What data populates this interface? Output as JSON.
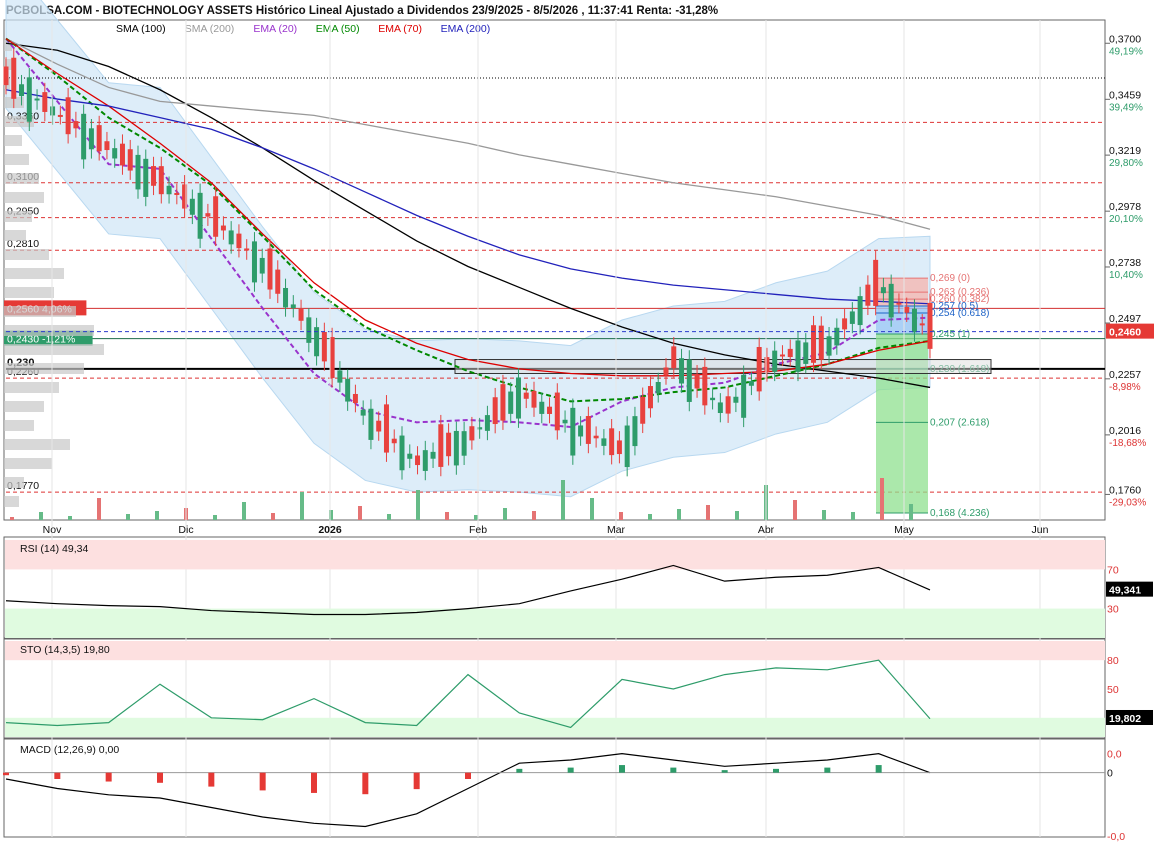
{
  "header": {
    "title": "PCBOLSA.COM - BIOTECHNOLOGY ASSETS Histórico Lineal Ajustado a Dividendos 23/9/2025 - 8/5/2026 , 11:37:41 Renta: -31,28%",
    "legend": [
      {
        "label": "SMA (100)",
        "color": "#000000"
      },
      {
        "label": "SMA (200)",
        "color": "#999999"
      },
      {
        "label": "EMA (20)",
        "color": "#9933cc"
      },
      {
        "label": "EMA (50)",
        "color": "#008800"
      },
      {
        "label": "EMA (70)",
        "color": "#dd0000"
      },
      {
        "label": "EMA (200)",
        "color": "#2222bb"
      }
    ]
  },
  "colors": {
    "up": "#2e9c6a",
    "down": "#e8413e",
    "bollinger": "#cfe6f7",
    "grid_red": "#dd3333"
  },
  "chart_data": [
    {
      "type": "candlestick",
      "title": "BIOTECHNOLOGY ASSETS",
      "x_ticks": [
        "Nov",
        "Dic",
        "2026",
        "Feb",
        "Mar",
        "Abr",
        "May",
        "Jun"
      ],
      "ylim": [
        0.165,
        0.38
      ],
      "y_ticks_right": [
        {
          "price": "0,3700",
          "pct": "49,19%",
          "y": 0.37
        },
        {
          "price": "0,3459",
          "pct": "39,49%",
          "y": 0.3459
        },
        {
          "price": "0,3219",
          "pct": "29,80%",
          "y": 0.3219
        },
        {
          "price": "0,2978",
          "pct": "20,10%",
          "y": 0.2978
        },
        {
          "price": "0,2738",
          "pct": "10,40%",
          "y": 0.2738
        },
        {
          "price": "0,2497",
          "pct": "",
          "y": 0.2497
        },
        {
          "price": "0,2257",
          "pct": "-8,98%",
          "y": 0.2257
        },
        {
          "price": "0,2016",
          "pct": "-18,68%",
          "y": 0.2016
        },
        {
          "price": "0,1760",
          "pct": "-29,03%",
          "y": 0.176
        }
      ],
      "current_price": "0,2460",
      "levels": [
        {
          "label": "0,3360",
          "y": 0.336
        },
        {
          "label": "0,3100",
          "y": 0.31
        },
        {
          "label": "0,2950",
          "y": 0.295
        },
        {
          "label": "0,2810",
          "y": 0.281
        },
        {
          "label": "0,2560 4,06%",
          "y": 0.256
        },
        {
          "label": "0,2430 -1,21%",
          "y": 0.243
        },
        {
          "label": "0,230",
          "y": 0.23
        },
        {
          "label": "0,2260",
          "y": 0.226
        },
        {
          "label": "0,1770",
          "y": 0.177
        }
      ],
      "fibonacci": [
        {
          "label": "0,269 (0)",
          "y": 0.269
        },
        {
          "label": "0,263 (0.236)",
          "y": 0.263
        },
        {
          "label": "0,260 (0.382)",
          "y": 0.26
        },
        {
          "label": "0,257 (0.5)",
          "y": 0.257
        },
        {
          "label": "0,254 (0.618)",
          "y": 0.254
        },
        {
          "label": "0,245 (1)",
          "y": 0.245
        },
        {
          "label": "0,230 (1.618)",
          "y": 0.23
        },
        {
          "label": "0,207 (2.618)",
          "y": 0.207
        },
        {
          "label": "0,168 (4.236)",
          "y": 0.168
        }
      ],
      "series": [
        {
          "name": "SMA (100)",
          "values": [
            0.37,
            0.367,
            0.36,
            0.35,
            0.338,
            0.325,
            0.311,
            0.298,
            0.285,
            0.274,
            0.265,
            0.256,
            0.248,
            0.241,
            0.236,
            0.232,
            0.229,
            0.226,
            0.222
          ]
        },
        {
          "name": "SMA (200)",
          "values": [
            0.372,
            0.361,
            0.351,
            0.345,
            0.343,
            0.341,
            0.339,
            0.335,
            0.331,
            0.327,
            0.322,
            0.318,
            0.314,
            0.31,
            0.307,
            0.304,
            0.3,
            0.296,
            0.29
          ]
        },
        {
          "name": "EMA (20)",
          "values": [
            0.372,
            0.345,
            0.318,
            0.316,
            0.286,
            0.256,
            0.228,
            0.212,
            0.207,
            0.208,
            0.207,
            0.205,
            0.216,
            0.222,
            0.224,
            0.232,
            0.237,
            0.251,
            0.252
          ]
        },
        {
          "name": "EMA (50)",
          "values": [
            0.372,
            0.356,
            0.338,
            0.325,
            0.309,
            0.287,
            0.264,
            0.248,
            0.238,
            0.229,
            0.222,
            0.216,
            0.217,
            0.22,
            0.222,
            0.227,
            0.232,
            0.239,
            0.242
          ]
        },
        {
          "name": "EMA (70)",
          "values": [
            0.372,
            0.357,
            0.343,
            0.327,
            0.31,
            0.288,
            0.267,
            0.251,
            0.241,
            0.234,
            0.23,
            0.228,
            0.227,
            0.227,
            0.228,
            0.229,
            0.232,
            0.238,
            0.242
          ]
        },
        {
          "name": "EMA (200)",
          "values": [
            0.35,
            0.346,
            0.343,
            0.338,
            0.333,
            0.325,
            0.316,
            0.306,
            0.296,
            0.287,
            0.279,
            0.273,
            0.269,
            0.266,
            0.264,
            0.262,
            0.26,
            0.259,
            0.258
          ]
        },
        {
          "name": "Precio",
          "values": [
            0.355,
            0.34,
            0.325,
            0.31,
            0.295,
            0.275,
            0.245,
            0.21,
            0.19,
            0.2,
            0.22,
            0.206,
            0.195,
            0.234,
            0.212,
            0.235,
            0.24,
            0.266,
            0.246
          ]
        }
      ]
    },
    {
      "type": "line",
      "title": "RSI (14)",
      "value_label": "49,34",
      "current": "49,341",
      "ylim": [
        0,
        100
      ],
      "levels": [
        "70",
        "30"
      ],
      "values": [
        38,
        35,
        33,
        32,
        28,
        26,
        24,
        24,
        26,
        30,
        35,
        48,
        60,
        74,
        58,
        62,
        64,
        72,
        49
      ]
    },
    {
      "type": "line",
      "title": "STO (14,3,5)",
      "value_label": "19,80",
      "current": "19,802",
      "ylim": [
        0,
        100
      ],
      "levels": [
        "80",
        "50"
      ],
      "values": [
        15,
        12,
        15,
        55,
        20,
        18,
        40,
        15,
        12,
        65,
        25,
        10,
        60,
        50,
        65,
        72,
        70,
        80,
        19
      ]
    },
    {
      "type": "line",
      "title": "MACD (12,26,9)",
      "value_label": "0,00",
      "ticks": [
        "0,0",
        "0",
        "-0,0"
      ],
      "values": [
        -0.002,
        -0.005,
        -0.007,
        -0.008,
        -0.011,
        -0.014,
        -0.016,
        -0.017,
        -0.013,
        -0.005,
        0.003,
        0.004,
        0.006,
        0.004,
        0.002,
        0.003,
        0.004,
        0.006,
        0.0
      ]
    }
  ]
}
